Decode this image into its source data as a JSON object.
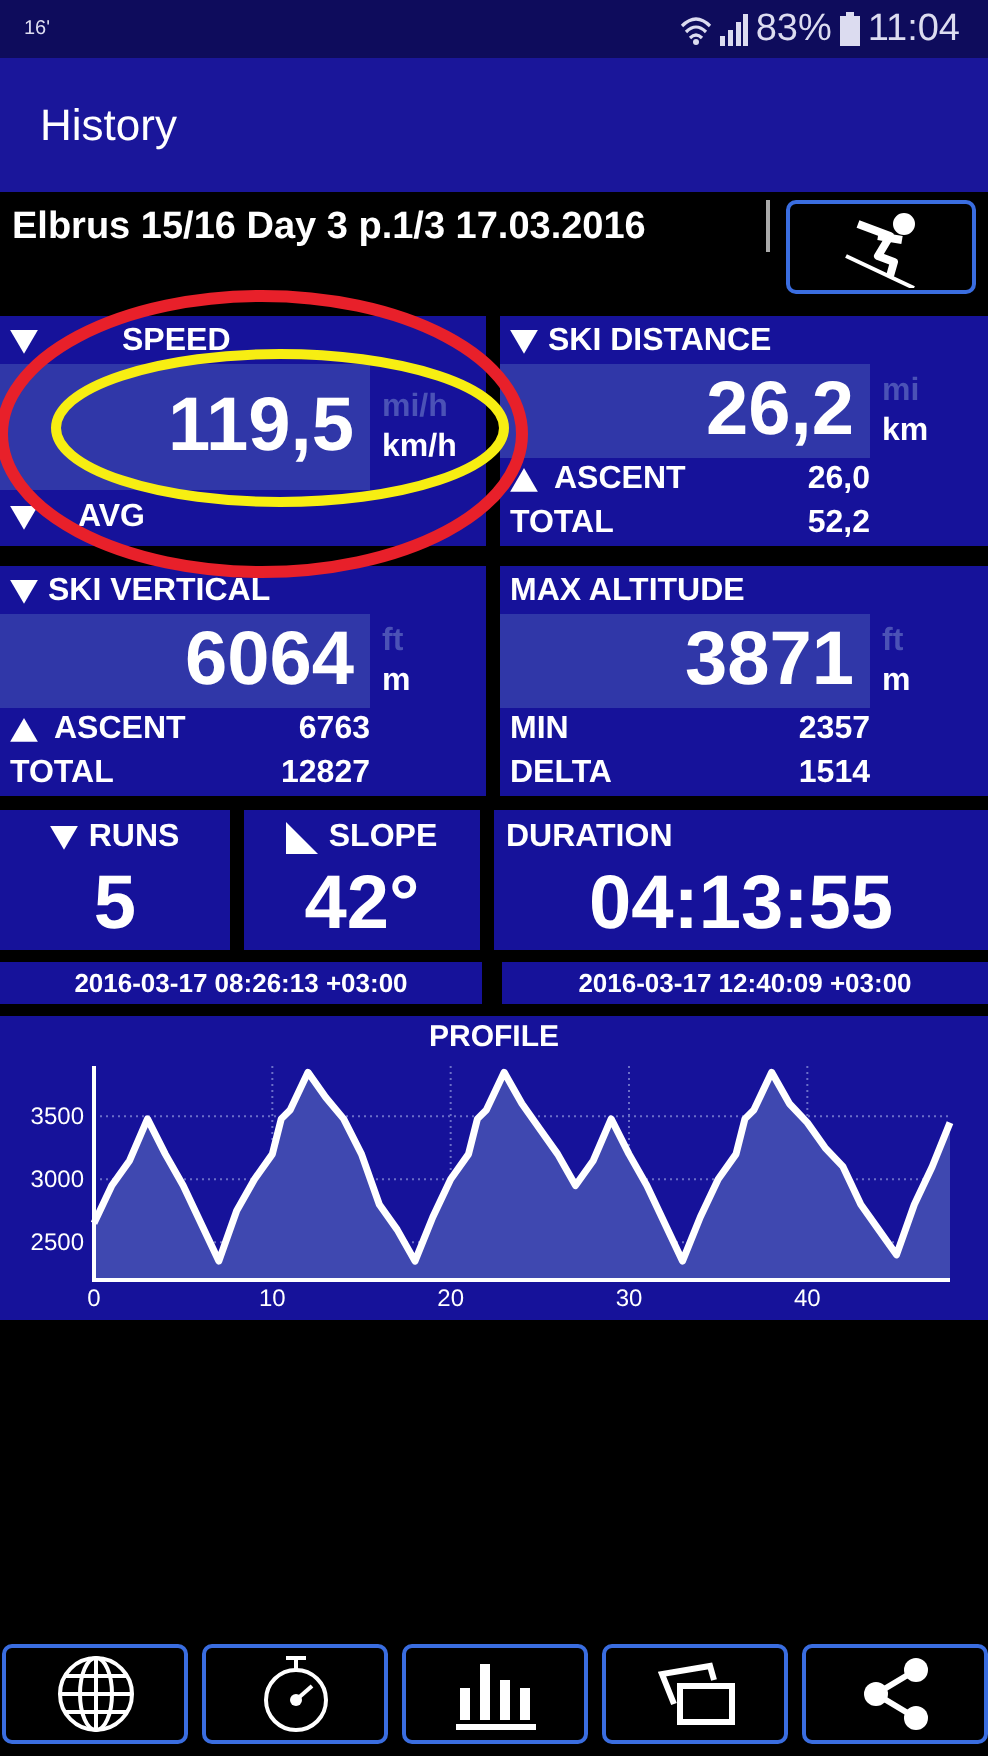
{
  "status_bar": {
    "notification": "16'",
    "battery": "83%",
    "time": "11:04"
  },
  "app_bar": {
    "title": "History"
  },
  "session": {
    "title": "Elbrus 15/16 Day 3 p.1/3 17.03.2016"
  },
  "panels": [
    {
      "label": "SPEED",
      "kind": "down",
      "value": "119,5",
      "units": [
        {
          "label": "mi/h",
          "selected": false
        },
        {
          "label": "km/h",
          "selected": true
        }
      ],
      "rows": [
        {
          "label": "AVG",
          "kind": "down"
        }
      ]
    },
    {
      "label": "SKI DISTANCE",
      "kind": "down",
      "value": "26,2",
      "units": [
        {
          "label": "mi",
          "selected": false
        },
        {
          "label": "km",
          "selected": true
        }
      ],
      "rows": [
        {
          "label": "ASCENT",
          "kind": "up",
          "value": "26,0"
        },
        {
          "label": "TOTAL",
          "kind": "plain",
          "value": "52,2"
        }
      ]
    },
    {
      "label": "SKI VERTICAL",
      "kind": "down",
      "value": "6064",
      "units": [
        {
          "label": "ft",
          "selected": false
        },
        {
          "label": "m",
          "selected": true
        }
      ],
      "rows": [
        {
          "label": "ASCENT",
          "kind": "up",
          "value": "6763"
        },
        {
          "label": "TOTAL",
          "kind": "plain",
          "value": "12827"
        }
      ]
    },
    {
      "label": "MAX ALTITUDE",
      "kind": "plain",
      "value": "3871",
      "units": [
        {
          "label": "ft",
          "selected": false
        },
        {
          "label": "m",
          "selected": true
        }
      ],
      "rows": [
        {
          "label": "MIN",
          "kind": "plain",
          "value": "2357"
        },
        {
          "label": "DELTA",
          "kind": "plain",
          "value": "1514"
        }
      ]
    }
  ],
  "small_panels": [
    {
      "label": "RUNS",
      "kind": "down",
      "value": "5"
    },
    {
      "label": "SLOPE",
      "kind": "slope",
      "value": "42°"
    },
    {
      "label": "DURATION",
      "kind": "plain",
      "value": "04:13:55"
    }
  ],
  "times": [
    "2016-03-17 08:26:13 +03:00",
    "2016-03-17 12:40:09 +03:00"
  ],
  "profile": {
    "chart_data": {
      "type": "area",
      "title": "PROFILE",
      "x": [
        0,
        1,
        2,
        3,
        4,
        5,
        7,
        8,
        9,
        10,
        10.5,
        11,
        12,
        13,
        14,
        15,
        16,
        17,
        18,
        19,
        20,
        21,
        21.5,
        22,
        23,
        24,
        25,
        26,
        27,
        28,
        29,
        30,
        31,
        33,
        34,
        35,
        36,
        36.5,
        37,
        38,
        39,
        40,
        41,
        42,
        43,
        44,
        45,
        46,
        47,
        48
      ],
      "series": [
        {
          "color": "#ffffff",
          "values": [
            2650,
            2950,
            3150,
            3480,
            3200,
            2950,
            2350,
            2750,
            3000,
            3200,
            3480,
            3550,
            3850,
            3650,
            3480,
            3200,
            2800,
            2600,
            2350,
            2700,
            3000,
            3200,
            3480,
            3550,
            3850,
            3600,
            3400,
            3200,
            2950,
            3150,
            3480,
            3200,
            2950,
            2350,
            2700,
            3000,
            3200,
            3480,
            3550,
            3850,
            3600,
            3450,
            3250,
            3100,
            2800,
            2600,
            2400,
            2800,
            3100,
            3450
          ]
        }
      ],
      "xlim": [
        0,
        48
      ],
      "ylim": [
        2200,
        3900
      ],
      "xticks": [
        0,
        10,
        20,
        30,
        40
      ],
      "yticks": [
        2500,
        3000,
        3500
      ],
      "grid": true
    }
  },
  "annotations": [
    {
      "kind": "ellipse",
      "color": "#e8202a"
    },
    {
      "kind": "ellipse",
      "color": "#f7ee12"
    }
  ]
}
